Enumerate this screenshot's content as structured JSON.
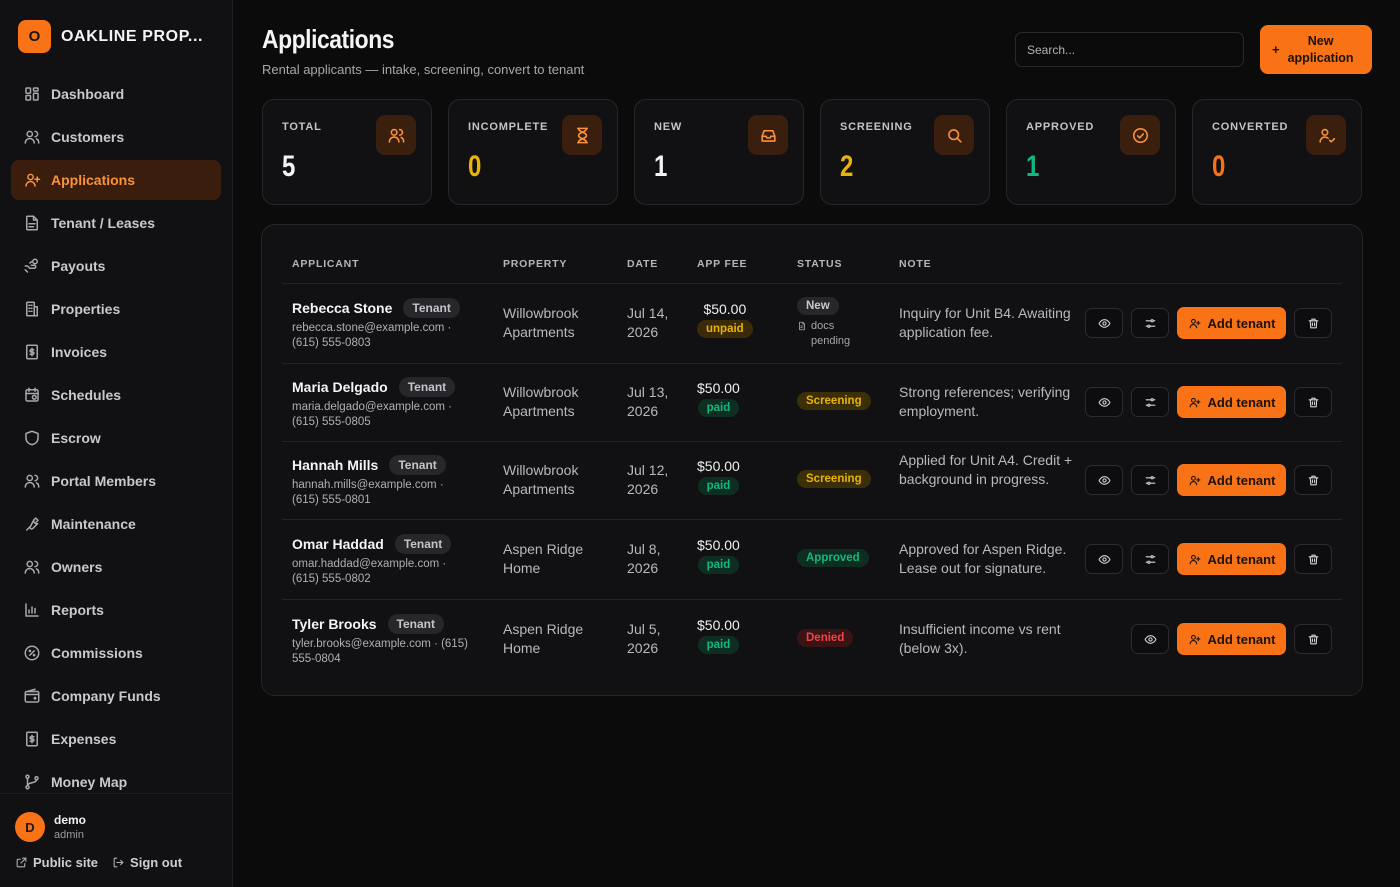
{
  "brand": {
    "logo_letter": "O",
    "name": "OAKLINE PROP..."
  },
  "sidebar": {
    "items": [
      {
        "label": "Dashboard",
        "icon": "dashboard-icon"
      },
      {
        "label": "Customers",
        "icon": "users-icon"
      },
      {
        "label": "Applications",
        "icon": "user-plus-icon",
        "active": true
      },
      {
        "label": "Tenant / Leases",
        "icon": "document-icon"
      },
      {
        "label": "Payouts",
        "icon": "payout-icon"
      },
      {
        "label": "Properties",
        "icon": "building-icon"
      },
      {
        "label": "Invoices",
        "icon": "invoice-icon"
      },
      {
        "label": "Schedules",
        "icon": "calendar-icon"
      },
      {
        "label": "Escrow",
        "icon": "shield-icon"
      },
      {
        "label": "Portal Members",
        "icon": "users-icon"
      },
      {
        "label": "Maintenance",
        "icon": "wrench-icon"
      },
      {
        "label": "Owners",
        "icon": "users-icon"
      },
      {
        "label": "Reports",
        "icon": "bar-chart-icon"
      },
      {
        "label": "Commissions",
        "icon": "percent-icon"
      },
      {
        "label": "Company Funds",
        "icon": "wallet-icon"
      },
      {
        "label": "Expenses",
        "icon": "receipt-icon"
      },
      {
        "label": "Money Map",
        "icon": "branch-icon"
      }
    ],
    "user": {
      "initial": "D",
      "name": "demo",
      "role": "admin"
    },
    "public_site": "Public site",
    "sign_out": "Sign out"
  },
  "header": {
    "title": "Applications",
    "subtitle": "Rental applicants — intake, screening, convert to tenant",
    "search_placeholder": "Search...",
    "new_button_plus": "+",
    "new_button": "New application"
  },
  "stats": [
    {
      "label": "TOTAL",
      "value": "5",
      "color": "#f4f4f5",
      "icon": "users-icon"
    },
    {
      "label": "INCOMPLETE",
      "value": "0",
      "color": "#eab308",
      "icon": "hourglass-icon"
    },
    {
      "label": "NEW",
      "value": "1",
      "color": "#f4f4f5",
      "icon": "inbox-icon"
    },
    {
      "label": "SCREENING",
      "value": "2",
      "color": "#eab308",
      "icon": "search-icon"
    },
    {
      "label": "APPROVED",
      "value": "1",
      "color": "#10b981",
      "icon": "check-circle-icon"
    },
    {
      "label": "CONVERTED",
      "value": "0",
      "color": "#f97316",
      "icon": "user-check-icon"
    }
  ],
  "table": {
    "columns": [
      "APPLICANT",
      "PROPERTY",
      "DATE",
      "APP FEE",
      "STATUS",
      "NOTE"
    ],
    "add_label": "Add tenant",
    "rows": [
      {
        "name": "Rebecca Stone",
        "tag": "Tenant",
        "contact": "rebecca.stone@example.com · (615) 555-0803",
        "property": "Willowbrook Apartments",
        "date": "Jul 14, 2026",
        "fee": "$50.00",
        "fee_status": "unpaid",
        "status": "New",
        "status_kind": "new",
        "status_note": "docs pending",
        "note": "Inquiry for Unit B4. Awaiting application fee.",
        "has_view": true
      },
      {
        "name": "Maria Delgado",
        "tag": "Tenant",
        "contact": "maria.delgado@example.com · (615) 555-0805",
        "property": "Willowbrook Apartments",
        "date": "Jul 13, 2026",
        "fee": "$50.00",
        "fee_status": "paid",
        "status": "Screening",
        "status_kind": "screen",
        "status_note": "",
        "note": "Strong references; verifying employment.",
        "has_view": true
      },
      {
        "name": "Hannah Mills",
        "tag": "Tenant",
        "contact": "hannah.mills@example.com · (615) 555-0801",
        "property": "Willowbrook Apartments",
        "date": "Jul 12, 2026",
        "fee": "$50.00",
        "fee_status": "paid",
        "status": "Screening",
        "status_kind": "screen",
        "status_note": "",
        "note": "Applied for Unit A4. Credit + background in progress.",
        "has_view": true
      },
      {
        "name": "Omar Haddad",
        "tag": "Tenant",
        "contact": "omar.haddad@example.com · (615) 555-0802",
        "property": "Aspen Ridge Home",
        "date": "Jul 8, 2026",
        "fee": "$50.00",
        "fee_status": "paid",
        "status": "Approved",
        "status_kind": "approved",
        "status_note": "",
        "note": "Approved for Aspen Ridge. Lease out for signature.",
        "has_view": true
      },
      {
        "name": "Tyler Brooks",
        "tag": "Tenant",
        "contact": "tyler.brooks@example.com · (615) 555-0804",
        "property": "Aspen Ridge Home",
        "date": "Jul 5, 2026",
        "fee": "$50.00",
        "fee_status": "paid",
        "status": "Denied",
        "status_kind": "denied",
        "status_note": "",
        "note": "Insufficient income vs rent (below 3x).",
        "has_view": false
      }
    ]
  },
  "colors": {
    "accent": "#f97316",
    "background": "#0b0b0c",
    "panel": "#111113"
  }
}
